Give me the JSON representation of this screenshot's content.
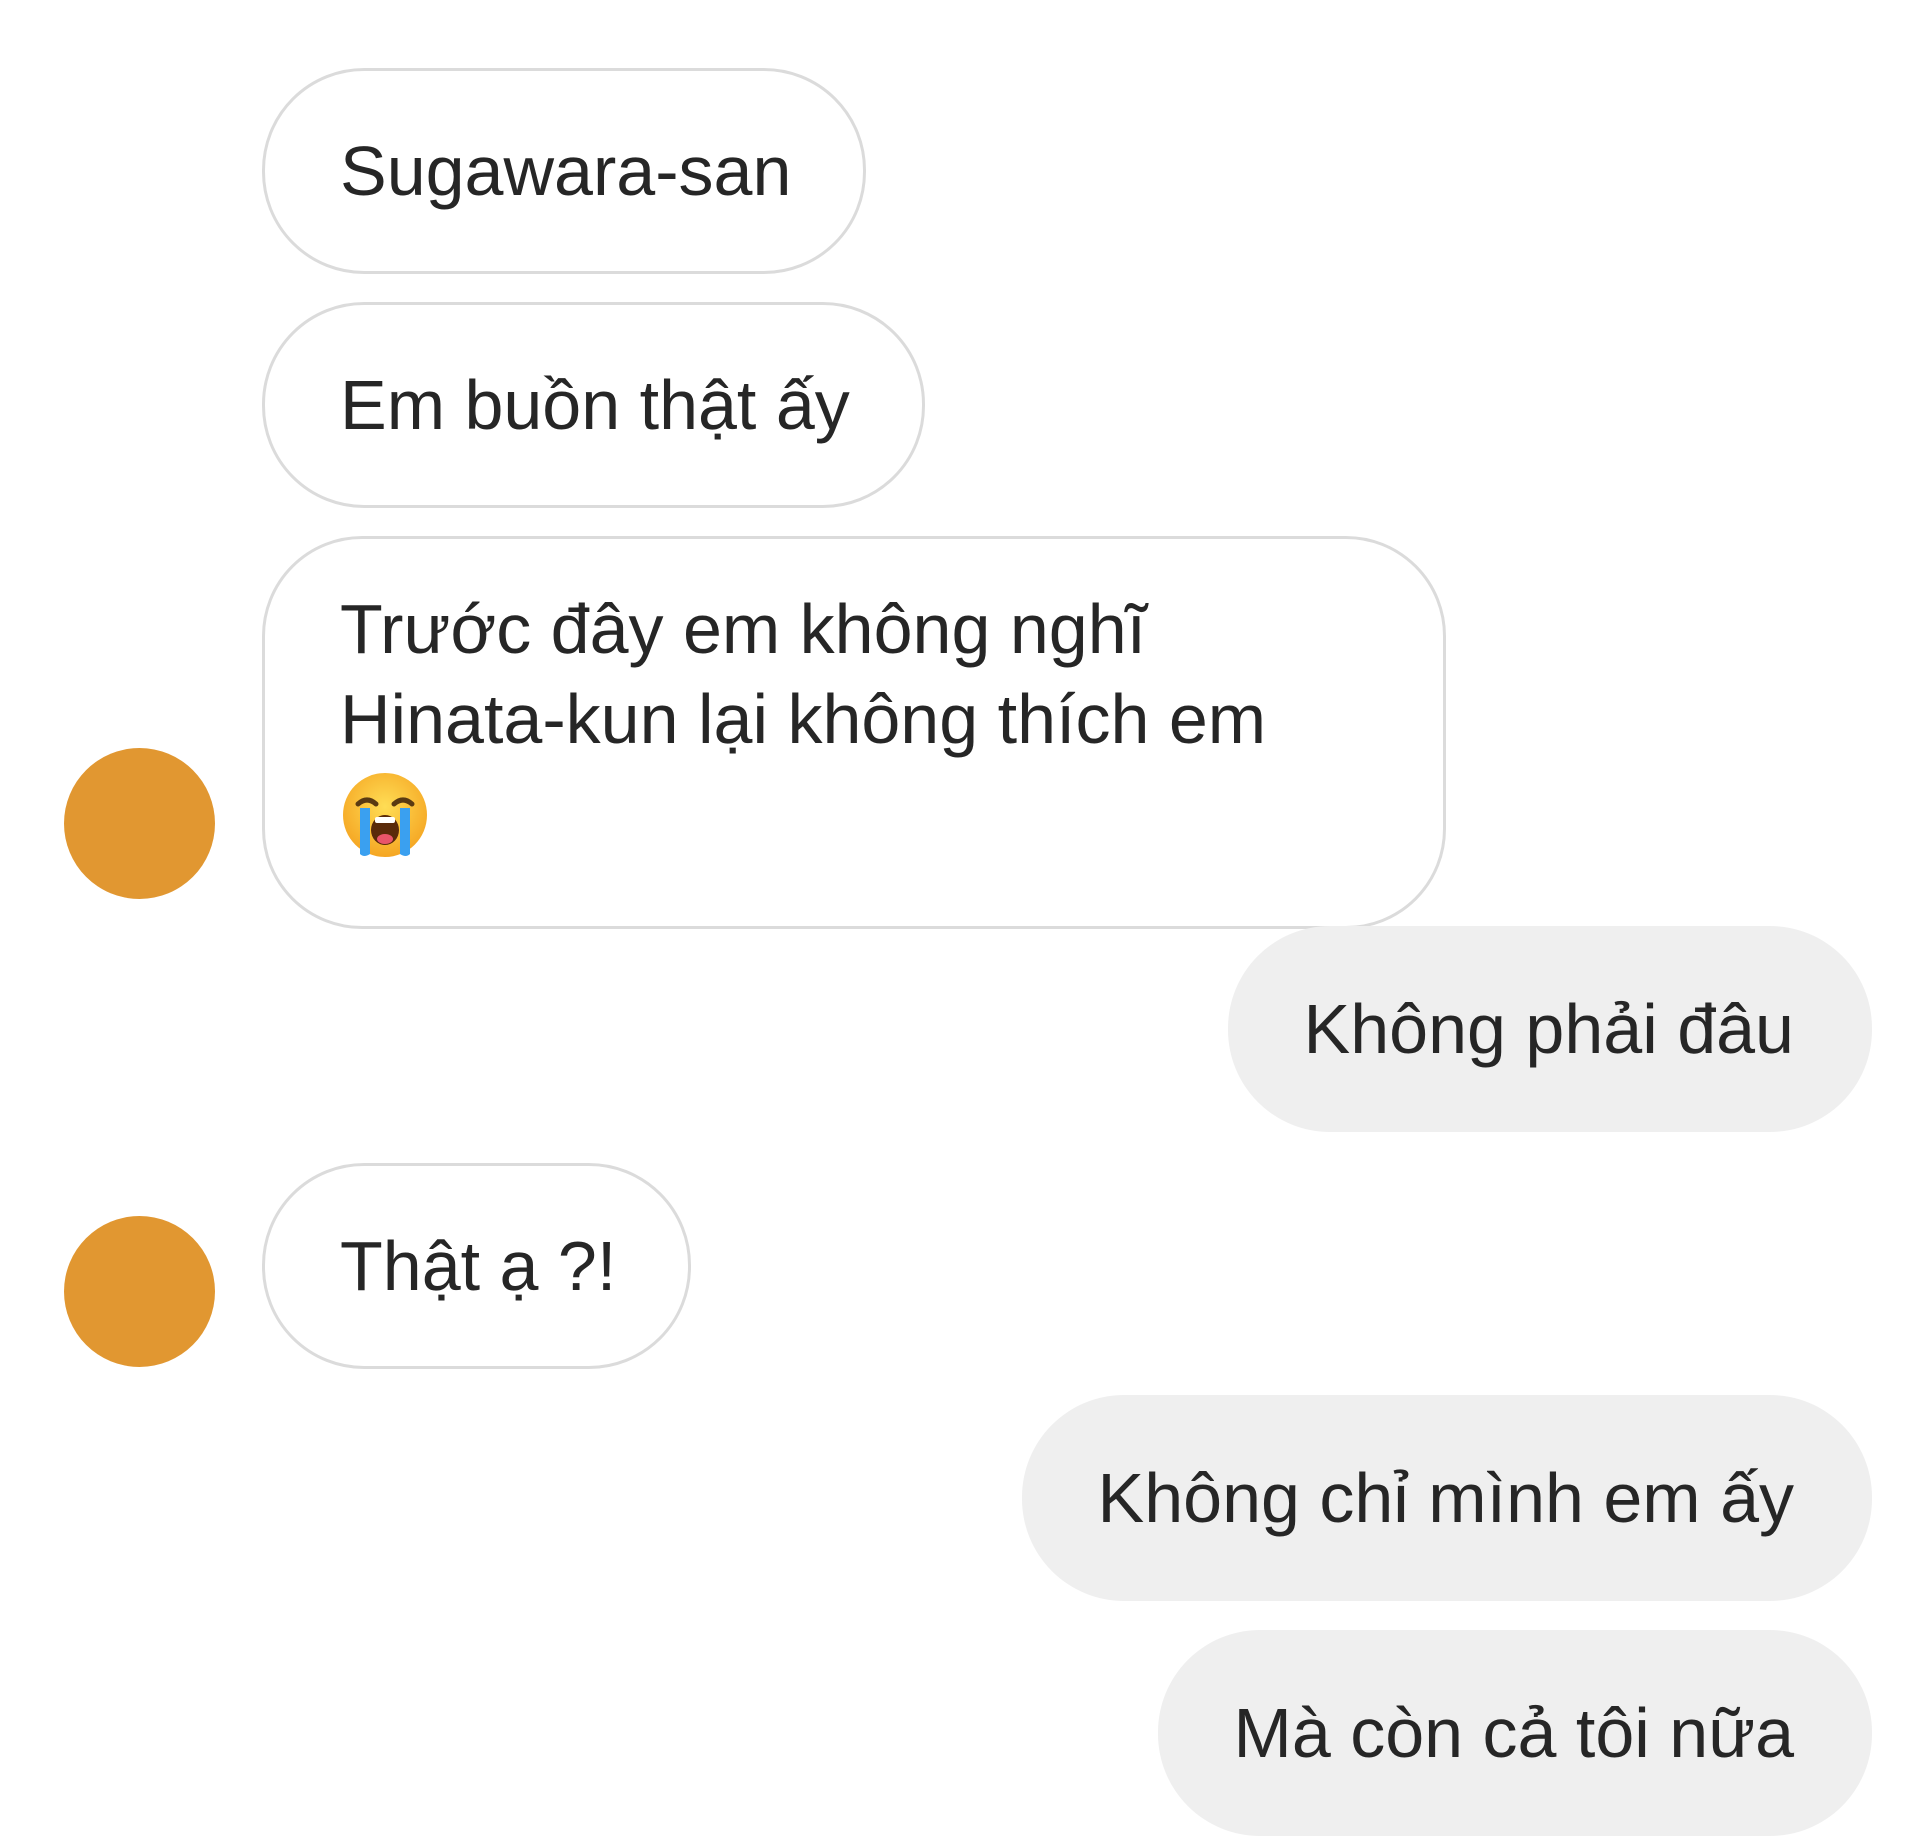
{
  "conversation": {
    "messages": [
      {
        "id": "m1",
        "side": "incoming",
        "text": "Sugawara-san"
      },
      {
        "id": "m2",
        "side": "incoming",
        "text": "Em buồn thật ấy"
      },
      {
        "id": "m3",
        "side": "incoming",
        "line1": "Trước đây em không nghĩ",
        "line2": "Hinata-kun lại không thích em",
        "emoji": "loudly-crying-face-icon"
      },
      {
        "id": "m4",
        "side": "outgoing",
        "text": "Không phải đâu"
      },
      {
        "id": "m5",
        "side": "incoming",
        "text": "Thật ạ ?!"
      },
      {
        "id": "m6",
        "side": "outgoing",
        "text": "Không chỉ mình em ấy"
      },
      {
        "id": "m7",
        "side": "outgoing",
        "text": "Mà còn cả tôi nữa"
      }
    ]
  },
  "colors": {
    "background": "#ffffff",
    "incoming_bubble": "#ffffff",
    "incoming_border": "#dbdbdb",
    "outgoing_bubble": "#efefef",
    "text": "#262626",
    "avatar": "#e19731"
  }
}
